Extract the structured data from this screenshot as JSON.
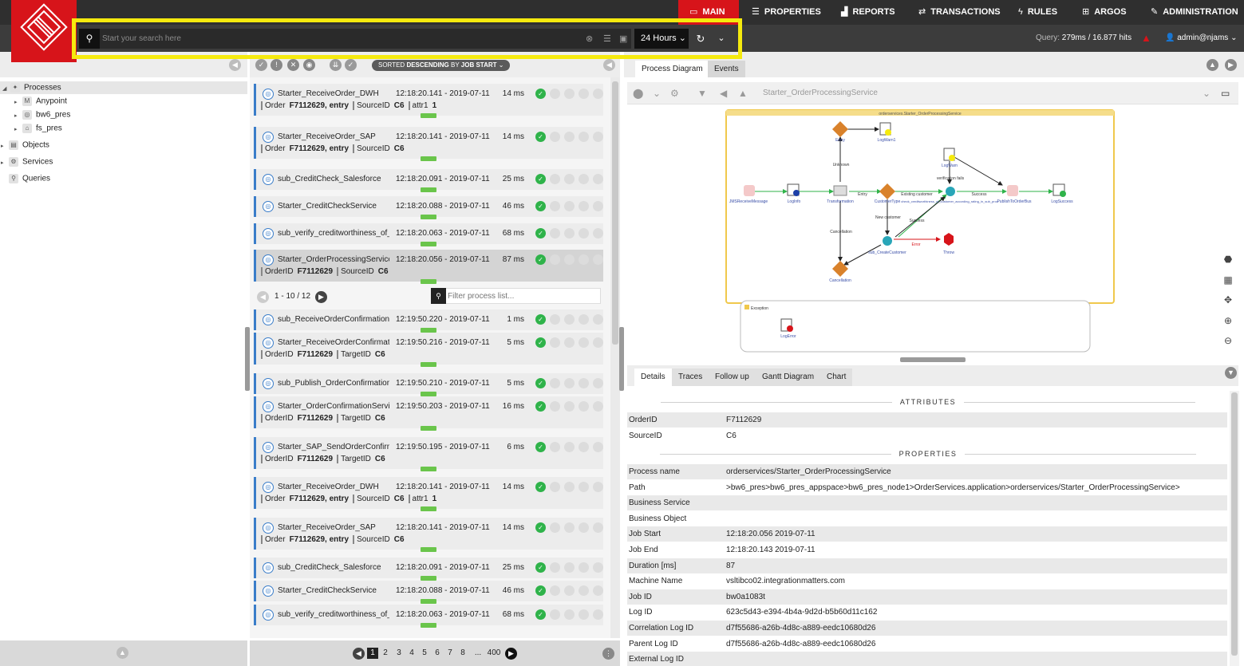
{
  "nav": {
    "items": [
      {
        "label": "MAIN",
        "icon": "monitor-icon",
        "active": true
      },
      {
        "label": "PROPERTIES",
        "icon": "list-icon"
      },
      {
        "label": "REPORTS",
        "icon": "chart-icon"
      },
      {
        "label": "TRANSACTIONS",
        "icon": "exchange-icon"
      },
      {
        "label": "RULES",
        "icon": "bolt-icon"
      },
      {
        "label": "ARGOS",
        "icon": "plus-square-icon"
      },
      {
        "label": "ADMINISTRATION",
        "icon": "wrench-icon"
      }
    ]
  },
  "search": {
    "placeholder": "Start your search here",
    "time_range": "24 Hours"
  },
  "status": {
    "query_label": "Query:",
    "query_value": "279ms / 16.877 hits",
    "user": "admin@njams"
  },
  "tree": {
    "items": [
      {
        "label": "Processes",
        "icon": "processes-icon"
      },
      {
        "label": "Anypoint",
        "icon": "anypoint-icon"
      },
      {
        "label": "bw6_pres",
        "icon": "bw-icon"
      },
      {
        "label": "fs_pres",
        "icon": "home-icon"
      },
      {
        "label": "Objects",
        "icon": "objects-icon"
      },
      {
        "label": "Services",
        "icon": "gear-icon"
      },
      {
        "label": "Queries",
        "icon": "search-icon"
      }
    ]
  },
  "list": {
    "sort_prefix": "SORTED",
    "sort_dir": "DESCENDING",
    "sort_by": "BY",
    "sort_field": "JOB START",
    "rows": [
      {
        "name": "Starter_ReceiveOrder_DWH",
        "time": "12:18:20.141 - 2019-07-11",
        "dur": "14 ms",
        "attrs": [
          [
            "Order",
            "F7112629, entry"
          ],
          [
            "SourceID",
            "C6"
          ],
          [
            "attr1",
            "1"
          ]
        ]
      },
      {
        "name": "Starter_ReceiveOrder_SAP",
        "time": "12:18:20.141 - 2019-07-11",
        "dur": "14 ms",
        "attrs": [
          [
            "Order",
            "F7112629, entry"
          ],
          [
            "SourceID",
            "C6"
          ]
        ]
      },
      {
        "name": "sub_CreditCheck_Salesforce",
        "time": "12:18:20.091 - 2019-07-11",
        "dur": "25 ms",
        "attrs": []
      },
      {
        "name": "Starter_CreditCheckService",
        "time": "12:18:20.088 - 2019-07-11",
        "dur": "46 ms",
        "attrs": []
      },
      {
        "name": "sub_verify_creditworthiness_of_",
        "time": "12:18:20.063 - 2019-07-11",
        "dur": "68 ms",
        "attrs": []
      },
      {
        "name": "Starter_OrderProcessingService",
        "time": "12:18:20.056 - 2019-07-11",
        "dur": "87 ms",
        "attrs": [
          [
            "OrderID",
            "F7112629"
          ],
          [
            "SourceID",
            "C6"
          ]
        ]
      }
    ],
    "sub_pager": "1 - 10 / 12",
    "filter_placeholder": "Filter process list...",
    "sub_rows": [
      {
        "name": "sub_ReceiveOrderConfirmation",
        "time": "12:19:50.220 - 2019-07-11",
        "dur": "1 ms",
        "attrs": []
      },
      {
        "name": "Starter_ReceiveOrderConfirmation",
        "time": "12:19:50.216 - 2019-07-11",
        "dur": "5 ms",
        "attrs": [
          [
            "OrderID",
            "F7112629"
          ],
          [
            "TargetID",
            "C6"
          ]
        ]
      },
      {
        "name": "sub_Publish_OrderConfirmation",
        "time": "12:19:50.210 - 2019-07-11",
        "dur": "5 ms",
        "attrs": []
      },
      {
        "name": "Starter_OrderConfirmationService",
        "time": "12:19:50.203 - 2019-07-11",
        "dur": "16 ms",
        "attrs": [
          [
            "OrderID",
            "F7112629"
          ],
          [
            "TargetID",
            "C6"
          ]
        ]
      },
      {
        "name": "Starter_SAP_SendOrderConfirmation",
        "time": "12:19:50.195 - 2019-07-11",
        "dur": "6 ms",
        "attrs": [
          [
            "OrderID",
            "F7112629"
          ],
          [
            "TargetID",
            "C6"
          ]
        ]
      },
      {
        "name": "Starter_ReceiveOrder_DWH",
        "time": "12:18:20.141 - 2019-07-11",
        "dur": "14 ms",
        "attrs": [
          [
            "Order",
            "F7112629, entry"
          ],
          [
            "SourceID",
            "C6"
          ],
          [
            "attr1",
            "1"
          ]
        ]
      },
      {
        "name": "Starter_ReceiveOrder_SAP",
        "time": "12:18:20.141 - 2019-07-11",
        "dur": "14 ms",
        "attrs": [
          [
            "Order",
            "F7112629, entry"
          ],
          [
            "SourceID",
            "C6"
          ]
        ]
      },
      {
        "name": "sub_CreditCheck_Salesforce",
        "time": "12:18:20.091 - 2019-07-11",
        "dur": "25 ms",
        "attrs": []
      },
      {
        "name": "Starter_CreditCheckService",
        "time": "12:18:20.088 - 2019-07-11",
        "dur": "46 ms",
        "attrs": []
      },
      {
        "name": "sub_verify_creditworthiness_of_",
        "time": "12:18:20.063 - 2019-07-11",
        "dur": "68 ms",
        "attrs": []
      }
    ],
    "pages": [
      "1",
      "2",
      "3",
      "4",
      "5",
      "6",
      "7",
      "8",
      "...",
      "400"
    ]
  },
  "right": {
    "tabs": [
      "Process Diagram",
      "Events"
    ],
    "diagram_title": "Starter_OrderProcessingService",
    "diagram": {
      "group_title": "orderservices.Starter_OrderProcessingService",
      "nodes": {
        "entry": "Entry",
        "logwarn1": "LogWarn1",
        "jms": "JMSReceiveMessage",
        "loginfo": "LogInfo",
        "transformation": "Transformation",
        "customertype": "CustomerType",
        "check": "check_creditworthiness_of_customer_according_rating_in_sub_proc",
        "logwarn": "LogWarn",
        "publish": "PublishToOrderBus",
        "logsuccess": "LogSuccess",
        "createcustomer": "sub_CreateCustomer",
        "throw": "Throw",
        "cancellation": "Cancellation",
        "exception": "Exception",
        "logerror": "LogError"
      },
      "edges": {
        "unknown": "Unknown",
        "entry": "Entry",
        "existing": "Existing customer",
        "newcust": "New customer",
        "verif": "verification fails",
        "success1": "Success",
        "success2": "Success",
        "cancellation": "Cancellation",
        "error": "Error"
      }
    },
    "detail_tabs": [
      "Details",
      "Traces",
      "Follow up",
      "Gantt Diagram",
      "Chart"
    ],
    "attributes_title": "ATTRIBUTES",
    "attributes": [
      [
        "OrderID",
        "F7112629"
      ],
      [
        "SourceID",
        "C6"
      ]
    ],
    "properties_title": "PROPERTIES",
    "properties": [
      [
        "Process name",
        "orderservices/Starter_OrderProcessingService"
      ],
      [
        "Path",
        ">bw6_pres>bw6_pres_appspace>bw6_pres_node1>OrderServices.application>orderservices/Starter_OrderProcessingService>"
      ],
      [
        "Business Service",
        ""
      ],
      [
        "Business Object",
        ""
      ],
      [
        "Job Start",
        "12:18:20.056   2019-07-11"
      ],
      [
        "Job End",
        "12:18:20.143   2019-07-11"
      ],
      [
        "Duration [ms]",
        "87"
      ],
      [
        "Machine Name",
        "vsltibco02.integrationmatters.com"
      ],
      [
        "Job ID",
        "bw0a1083t"
      ],
      [
        "Log ID",
        "623c5d43-e394-4b4a-9d2d-b5b60d11c162"
      ],
      [
        "Correlation Log ID",
        "d7f55686-a26b-4d8c-a889-eedc10680d26"
      ],
      [
        "Parent Log ID",
        "d7f55686-a26b-4d8c-a889-eedc10680d26"
      ],
      [
        "External Log ID",
        ""
      ]
    ]
  },
  "colors": {
    "brand": "#d7141a",
    "highlight": "#f5ea0e",
    "ok": "#2fb34a",
    "link": "#3a7dc9"
  }
}
